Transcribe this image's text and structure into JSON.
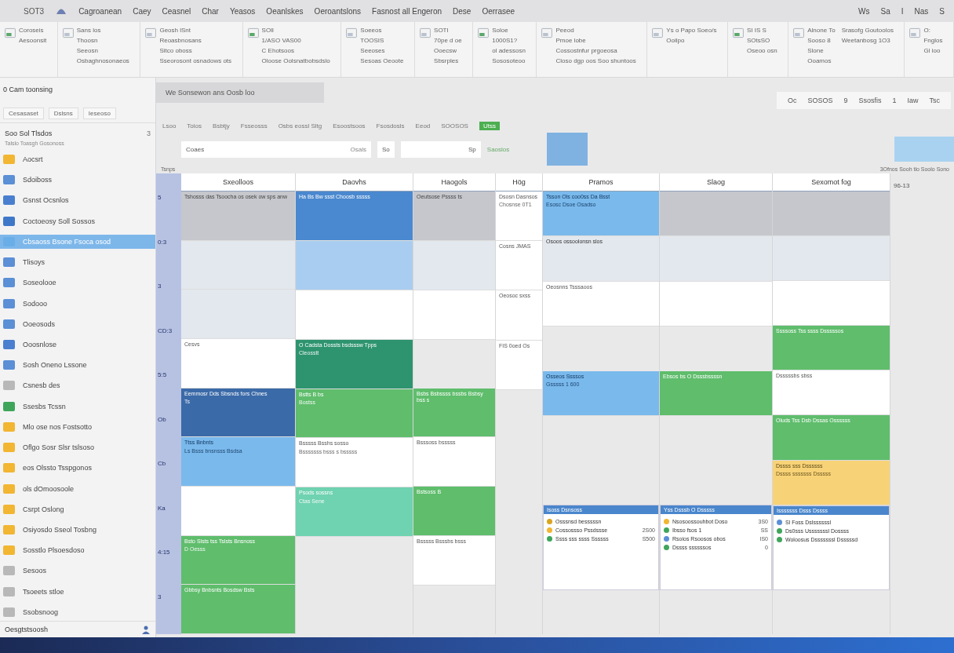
{
  "menu_bar": {
    "app": "SOT3",
    "items": [
      "Cagroanean",
      "Caey",
      "Ceasnel",
      "Char",
      "Yeasos",
      "Oeanlskes",
      "Oeroantslons",
      "Fasnost all Engeron",
      "Dese",
      "Oerrasee"
    ],
    "right": [
      "Ws",
      "Sa",
      "I",
      "Nas",
      "S"
    ]
  },
  "ribbon": {
    "groups": [
      {
        "lines": [
          "Coroseis",
          "Aesoonsit"
        ]
      },
      {
        "lines": [
          "Sans los",
          "Thoosn",
          "Seeosn",
          "Osbaghnosonaeos"
        ]
      },
      {
        "lines": [
          "Geosh lSnt",
          "Reoasbnosans",
          "Sitco oboss",
          "Sseorosont osnadows ots"
        ]
      },
      {
        "lines": [
          "SOll",
          "1/ASO VAS00",
          "C Ehotsoos",
          "Oloose Oolsnatbobsdslo"
        ]
      },
      {
        "lines": [
          "Soeeos",
          "TOOSIS",
          "Seeoses",
          "Sesoas Oeoote"
        ]
      },
      {
        "lines": [
          "SOTI",
          "70pe d oe",
          "Ooecsw",
          "Sbsrples"
        ]
      },
      {
        "lines": [
          "Soloe",
          "1000S1?",
          "ol adessosn",
          "Sososoteoo"
        ]
      },
      {
        "lines": [
          "Peeod",
          "Pmoe lobe",
          "Cossostnfur prgoeosa",
          "Closo dgp oos Soo shuntoos"
        ]
      },
      {
        "lines": [
          "Ys o Papo Soeo/s",
          "Ooilpo"
        ]
      },
      {
        "lines": [
          "SI IS S",
          "SOtsSO",
          "Oseoo osn"
        ]
      },
      {
        "lines": [
          "Alnone To",
          "Sooso 8",
          "Slone",
          "Ooamos",
          "Srasofg Goutoolos",
          "Weetanbosg 1O3"
        ]
      },
      {
        "lines": [
          "O:",
          "Fnglos",
          "Gl ioo"
        ]
      }
    ]
  },
  "sidebar": {
    "title": "0 Cam toonsing",
    "tab": "We Sonsewon ans Oosb loo",
    "filters": [
      "Cesasaset",
      "Dslsns",
      "Ieseoso"
    ],
    "heading": "Soo Sol Tlsdos",
    "count": "3",
    "subheading": "Talslo Toasgh Gosonoss",
    "items": [
      {
        "label": "Aocsrt",
        "color": "#f2b632",
        "selected": false
      },
      {
        "label": "Sdoiboss",
        "color": "#5b8fd6",
        "selected": false
      },
      {
        "label": "Gsnst Ocsnlos",
        "color": "#4a7fd0",
        "selected": false
      },
      {
        "label": "Coctoeosy Soll Sossos",
        "color": "#3f78c9",
        "selected": false
      },
      {
        "label": "Cbsaoss Bsone  Fsoca osod",
        "color": "#6aaee8",
        "selected": true
      },
      {
        "label": "Tlisoys",
        "color": "#5b8fd6",
        "selected": false
      },
      {
        "label": "Soseolooe",
        "color": "#5b8fd6",
        "selected": false
      },
      {
        "label": "Sodooo",
        "color": "#5b8fd6",
        "selected": false
      },
      {
        "label": "Ooeosods",
        "color": "#5b8fd6",
        "selected": false
      },
      {
        "label": "Ooosnlose",
        "color": "#4a7fd0",
        "selected": false
      },
      {
        "label": "Sosh Oneno Lssone",
        "color": "#5b8fd6",
        "selected": false
      },
      {
        "label": "Csnesb des",
        "color": "#b8b8b8",
        "selected": false
      },
      {
        "label": "Ssesbs Tcssn",
        "color": "#3fa55b",
        "selected": false
      },
      {
        "label": "Mlo ose nos Fostsotto",
        "color": "#f2b632",
        "selected": false
      },
      {
        "label": "Oflgo Sosr Slsr tslsoso",
        "color": "#f2b632",
        "selected": false
      },
      {
        "label": "eos Olssto Tsspgonos",
        "color": "#f2b632",
        "selected": false
      },
      {
        "label": "ols dOmoosoole",
        "color": "#f2b632",
        "selected": false
      },
      {
        "label": "Csrpt Oslong",
        "color": "#f2b632",
        "selected": false
      },
      {
        "label": "Osiyosdo Sseol Tosbng",
        "color": "#f2b632",
        "selected": false
      },
      {
        "label": "Sosstlo Plsoesdoso",
        "color": "#f2b632",
        "selected": false
      },
      {
        "label": "Sesoos",
        "color": "#b8b8b8",
        "selected": false
      },
      {
        "label": "Tsoeets stloe",
        "color": "#b8b8b8",
        "selected": false
      },
      {
        "label": "Ssobsnoog",
        "color": "#b8b8b8",
        "selected": false
      }
    ],
    "footer": "Oesgtstsoosh"
  },
  "toolbar": {
    "items": [
      "Lsoo",
      "Tolos",
      "Bsbtjy",
      "Fsseosss",
      "Osbs eossl Sltg",
      "Esoostsoos",
      "Fsosdosls",
      "Eeod",
      "SOOSOS"
    ],
    "range": [
      "Oc",
      "SOSOS",
      "9",
      "Ssosfis",
      "1",
      "Iaw",
      "Tsc"
    ],
    "badge": "Utss"
  },
  "search": {
    "value": "Coaes",
    "hint": "Osals",
    "button": "So",
    "second": "Sp",
    "label": "Saoslos"
  },
  "week_label": "Tsnps",
  "zoom_label": "3Ofnos Sooh tlo Soolo Sono",
  "corner": "96-13",
  "columns": [
    "Sxeolloos",
    "Daovhs",
    "Haogols",
    "Hög",
    "Pramos",
    "Slaog",
    "Sexomot fog"
  ],
  "times": [
    "5",
    "0:3",
    "3",
    "CD:3",
    "5:5",
    "Ob",
    "Cb",
    "Ka",
    "4:15",
    "3"
  ],
  "days": [
    [
      {
        "kind": "gray",
        "title": "Tshosss das Tsoocha os osek ow sps anw"
      },
      {
        "kind": "pale"
      },
      {
        "kind": "pale"
      },
      {
        "kind": "white",
        "title": "Cesvs"
      },
      {
        "kind": "navy",
        "title": "Eemmosr Dds Sbsnds fors Chnes",
        "note": "Ts"
      },
      {
        "kind": "sky",
        "title": "Ttss Bnbnts",
        "note": "Ls Bsss bnsnsss Bsdsa"
      },
      {
        "kind": "white"
      },
      {
        "kind": "green",
        "title": "Bsto Slsts tss Tslsts Bnsnoss",
        "note": "D Oesss"
      },
      {
        "kind": "green",
        "title": "Gbbsy Bnbsnts Bosdsw Bsts"
      }
    ],
    [
      {
        "kind": "blue",
        "title": "Ha Bs Bw ssst Choosb sssss"
      },
      {
        "kind": "paleblue"
      },
      {
        "kind": "white"
      },
      {
        "kind": "teal",
        "title": "O Cadsta Dossts bsdsssw Tpps",
        "note": "Cleosstt"
      },
      {
        "kind": "green",
        "title": "Bstts B bs",
        "note": "Bostss"
      },
      {
        "kind": "white",
        "title": "Bsssss Bsshs sosso",
        "note": "Bsssssss bsss s bsssss"
      },
      {
        "kind": "mint",
        "title": "Psods sossns",
        "note": "Ctas Sene"
      },
      {
        "kind": "empty"
      },
      {
        "kind": "empty"
      }
    ],
    [
      {
        "kind": "gray",
        "title": "Oeutsose Pssss ts"
      },
      {
        "kind": "pale"
      },
      {
        "kind": "white"
      },
      {
        "kind": "empty"
      },
      {
        "kind": "green",
        "title": "Bsbs Bsbssss bssbs Bsbsy bss s"
      },
      {
        "kind": "white",
        "title": "Bsssoss bsssss"
      },
      {
        "kind": "green",
        "title": "Bstsoss B"
      },
      {
        "kind": "white",
        "title": "Bsssss Bsssbs bsss"
      },
      {
        "kind": "empty"
      }
    ],
    [
      {
        "kind": "white",
        "title": "Dsosn Dasnsos",
        "note": "Chosnse 0T1"
      },
      {
        "kind": "white",
        "title": "Cosns JMAS"
      },
      {
        "kind": "white",
        "title": "Oeosoc sxss"
      },
      {
        "kind": "white",
        "title": "FIS 0oed Os"
      },
      {
        "kind": "empty"
      },
      {
        "kind": "empty"
      },
      {
        "kind": "empty"
      },
      {
        "kind": "empty"
      },
      {
        "kind": "empty"
      }
    ],
    [
      {
        "kind": "sky",
        "title": "Tsson Ols coo0ss Da Bsst",
        "note": "Esosc Dsoe Osadso"
      },
      {
        "kind": "pale",
        "title": "Osoos ossoolonsn slos"
      },
      {
        "kind": "white",
        "title": "Oeosnns Tsssaoos"
      },
      {
        "kind": "empty"
      },
      {
        "kind": "sky",
        "title": "Osseos Ssssos",
        "note": "Gsssss 1 600"
      },
      {
        "kind": "empty"
      },
      {
        "kind": "empty"
      },
      {
        "kind": "list",
        "title": "Isoss Dsnsoss",
        "rows": [
          {
            "text": "Osssnsd besssssn",
            "value": "",
            "color": "#d9a520"
          },
          {
            "text": "Cossossso Pssdssse",
            "value": "2S00",
            "color": "#f2b632"
          },
          {
            "text": "Ssss sss ssss Ssssss",
            "value": "S500",
            "color": "#3fa55b"
          }
        ]
      },
      {
        "kind": "empty"
      }
    ],
    [
      {
        "kind": "gray"
      },
      {
        "kind": "pale"
      },
      {
        "kind": "white"
      },
      {
        "kind": "empty"
      },
      {
        "kind": "green",
        "title": "Ebsos bs O Dsssbssssn"
      },
      {
        "kind": "empty"
      },
      {
        "kind": "empty"
      },
      {
        "kind": "list",
        "title": "Yss Dsssb O Dsssss",
        "rows": [
          {
            "text": "Nsosoossouhbot Doso",
            "value": "3S0",
            "color": "#f2b632"
          },
          {
            "text": "Ibsso fsos 1",
            "value": "SS",
            "color": "#3fa55b"
          },
          {
            "text": "Rsoios Rsoosos obos",
            "value": "IS0",
            "color": "#5b8fd6"
          },
          {
            "text": "Dssss ssssssos",
            "value": "0",
            "color": "#3fa55b"
          }
        ]
      },
      {
        "kind": "empty"
      }
    ],
    [
      {
        "kind": "gray"
      },
      {
        "kind": "pale"
      },
      {
        "kind": "white"
      },
      {
        "kind": "green",
        "title": "Ssssoss Tss ssss Dsssssos"
      },
      {
        "kind": "white",
        "title": "Dsssssbs sbss"
      },
      {
        "kind": "green",
        "title": "Oluds Tss Dsb Dssas Ossssss"
      },
      {
        "kind": "yellow",
        "title": "Dssss sss Dssssss",
        "note": "Dssss sssssss Dsssss"
      },
      {
        "kind": "list",
        "title": "Isssssss Dsss Dssss",
        "rows": [
          {
            "text": "Sl Foss  Dslssssssl",
            "value": "",
            "color": "#5b8fd6"
          },
          {
            "text": "Ds0sss  Usssssssl Dossss",
            "value": "",
            "color": "#3fa55b"
          },
          {
            "text": "Woloosus  Dsssssssl Dsssssd",
            "value": "",
            "color": "#3fa55b"
          }
        ]
      },
      {
        "kind": "empty"
      }
    ]
  ]
}
